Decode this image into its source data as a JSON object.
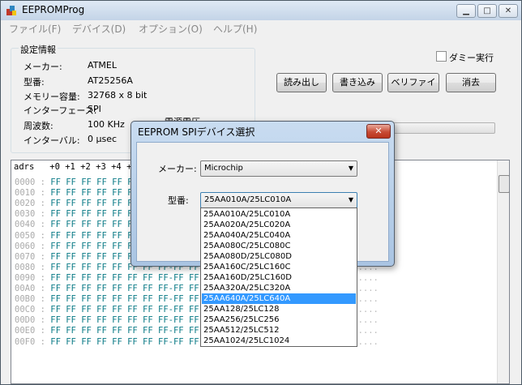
{
  "window": {
    "title": "EEPROMProg",
    "icon": "app-icon",
    "controls": [
      "minimize-icon",
      "maximize-icon",
      "close-icon"
    ]
  },
  "menu": [
    {
      "label": "ファイル(F)"
    },
    {
      "label": "デバイス(D)"
    },
    {
      "label": "オプション(O)"
    },
    {
      "label": "ヘルプ(H)"
    }
  ],
  "settings": {
    "group_title": "設定情報",
    "rows": [
      {
        "label": "メーカー:",
        "value": "ATMEL"
      },
      {
        "label": "型番:",
        "value": "AT25256A"
      },
      {
        "label": "メモリー容量:",
        "value": "32768 x 8 bit"
      },
      {
        "label": "インターフェース:",
        "value": "SPI"
      },
      {
        "label": "周波数:",
        "value": "100 KHz"
      },
      {
        "label": "インターバル:",
        "value": "0 μsec"
      }
    ]
  },
  "dummy_checkbox": {
    "label": "ダミー実行",
    "checked": false
  },
  "buttons": {
    "read": "読み出し",
    "write": "書き込み",
    "verify": "ベリファイ",
    "erase": "消去"
  },
  "progress": {
    "label": "電源電圧",
    "value": 0
  },
  "hex": {
    "header": "adrs   +0 +1 +2 +3 +4 +5 +6 +7 +8 +9 +A +B +C +D +E +F",
    "rows": [
      {
        "addr": "0000 :",
        "bytes": "FF FF FF FF FF FF FF FF-FF FF FF FF FF FF FF FF",
        "ascii": "................"
      },
      {
        "addr": "0010 :",
        "bytes": "FF FF FF FF FF FF FF FF-FF FF FF FF FF FF FF FF",
        "ascii": "................"
      },
      {
        "addr": "0020 :",
        "bytes": "FF FF FF FF FF FF FF FF-FF FF FF FF FF FF FF FF",
        "ascii": "................"
      },
      {
        "addr": "0030 :",
        "bytes": "FF FF FF FF FF FF FF FF-FF FF FF FF FF FF FF FF",
        "ascii": "................"
      },
      {
        "addr": "0040 :",
        "bytes": "FF FF FF FF FF FF FF FF-FF FF FF FF FF FF FF FF",
        "ascii": "................"
      },
      {
        "addr": "0050 :",
        "bytes": "FF FF FF FF FF FF FF FF-FF FF FF FF FF FF FF FF",
        "ascii": "................"
      },
      {
        "addr": "0060 :",
        "bytes": "FF FF FF FF FF FF FF FF-FF FF FF FF FF FF FF FF",
        "ascii": "................"
      },
      {
        "addr": "0070 :",
        "bytes": "FF FF FF FF FF FF FF FF-FF FF FF FF FF FF FF FF",
        "ascii": "................"
      },
      {
        "addr": "0080 :",
        "bytes": "FF FF FF FF FF FF FF FF-FF FF FF FF FF FF FF FF",
        "ascii": "................"
      },
      {
        "addr": "0090 :",
        "bytes": "FF FF FF FF FF FF FF FF-FF FF FF FF FF FF FF FF",
        "ascii": "................"
      },
      {
        "addr": "00A0 :",
        "bytes": "FF FF FF FF FF FF FF FF-FF FF FF FF FF FF FF FF",
        "ascii": "................"
      },
      {
        "addr": "00B0 :",
        "bytes": "FF FF FF FF FF FF FF FF-FF FF FF FF FF FF FF FF",
        "ascii": "................"
      },
      {
        "addr": "00C0 :",
        "bytes": "FF FF FF FF FF FF FF FF-FF FF FF FF FF FF FF FF",
        "ascii": "................"
      },
      {
        "addr": "00D0 :",
        "bytes": "FF FF FF FF FF FF FF FF-FF FF FF FF FF FF FF FF",
        "ascii": "................"
      },
      {
        "addr": "00E0 :",
        "bytes": "FF FF FF FF FF FF FF FF-FF FF FF FF FF FF FF FF",
        "ascii": "................"
      },
      {
        "addr": "00F0 :",
        "bytes": "FF FF FF FF FF FF FF FF-FF FF FF FF FF FF FF FF",
        "ascii": "................"
      }
    ]
  },
  "dialog": {
    "title": "EEPROM SPIデバイス選択",
    "maker_label": "メーカー:",
    "maker_value": "Microchip",
    "model_label": "型番:",
    "model_value": "25AA010A/25LC010A",
    "options": [
      "25AA010A/25LC010A",
      "25AA020A/25LC020A",
      "25AA040A/25LC040A",
      "25AA080C/25LC080C",
      "25AA080D/25LC080D",
      "25AA160C/25LC160C",
      "25AA160D/25LC160D",
      "25AA320A/25LC320A",
      "25AA640A/25LC640A",
      "25AA128/25LC128",
      "25AA256/25LC256",
      "25AA512/25LC512",
      "25AA1024/25LC1024"
    ],
    "selected_index": 8
  }
}
